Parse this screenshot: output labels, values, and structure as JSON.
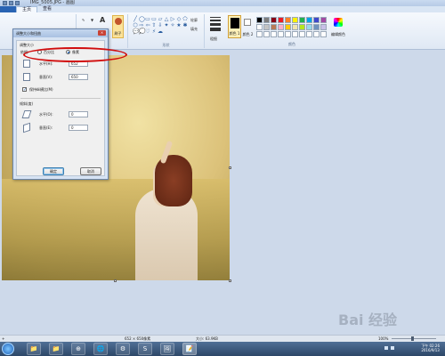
{
  "window": {
    "title": "IMG_5005.JPG - 画图"
  },
  "tabs": {
    "file_menu": "",
    "home": "主页",
    "view": "查看"
  },
  "ribbon": {
    "shapes_label": "形状",
    "colors_label": "颜色",
    "brush_label": "刷子",
    "size_label": "粗细",
    "color1_label": "颜色 1",
    "color2_label": "颜色 2",
    "edit_colors_label": "编辑颜色",
    "outline_label": "轮廓",
    "fill_label": "填充",
    "shape_icons": [
      "╱",
      "◯",
      "▭",
      "▭",
      "▱",
      "△",
      "▷",
      "◇",
      "⬠",
      "⬡",
      "⇨",
      "⇦",
      "⇧",
      "⇩",
      "✦",
      "✧",
      "★",
      "✱",
      "💬",
      "💭",
      "♡",
      "⚡",
      "☁"
    ],
    "palette": [
      "#000000",
      "#7f7f7f",
      "#880015",
      "#ed1c24",
      "#ff7f27",
      "#fff200",
      "#22b14c",
      "#00a2e8",
      "#3f48cc",
      "#a349a4",
      "#ffffff",
      "#c3c3c3",
      "#b97a57",
      "#ffaec9",
      "#ffc90e",
      "#efe4b0",
      "#b5e61d",
      "#99d9ea",
      "#7092be",
      "#c8bfe7",
      "#ffffff",
      "#ffffff",
      "#ffffff",
      "#ffffff",
      "#ffffff",
      "#ffffff",
      "#ffffff",
      "#ffffff",
      "#ffffff",
      "#ffffff"
    ]
  },
  "dialog": {
    "title": "调整大小和扭曲",
    "close": "×",
    "resize_section": "调整大小",
    "by_label": "依据:",
    "percent_option": "百分比",
    "pixel_option": "像素",
    "pixel_selected": true,
    "horizontal_label": "水平(H):",
    "horizontal_value": "652",
    "vertical_label": "垂直(V):",
    "vertical_value": "650",
    "keep_ratio_label": "保持纵横比(M)",
    "keep_ratio_checked": true,
    "skew_section": "倾斜(度)",
    "skew_horizontal_label": "水平(O):",
    "skew_horizontal_value": "0",
    "skew_vertical_label": "垂直(E):",
    "skew_vertical_value": "0",
    "ok": "确定",
    "cancel": "取消"
  },
  "statusbar": {
    "dimensions": "652 × 650像素",
    "size": "大小: 63.9KB",
    "zoom": "100%"
  },
  "taskbar": {
    "time": "下午 02:26",
    "date": "2016/9/13",
    "apps": [
      "📁",
      "📁",
      "⊕",
      "🌐",
      "⚙",
      "S",
      "🖼",
      "📝"
    ]
  },
  "watermark": "Bai 经验"
}
